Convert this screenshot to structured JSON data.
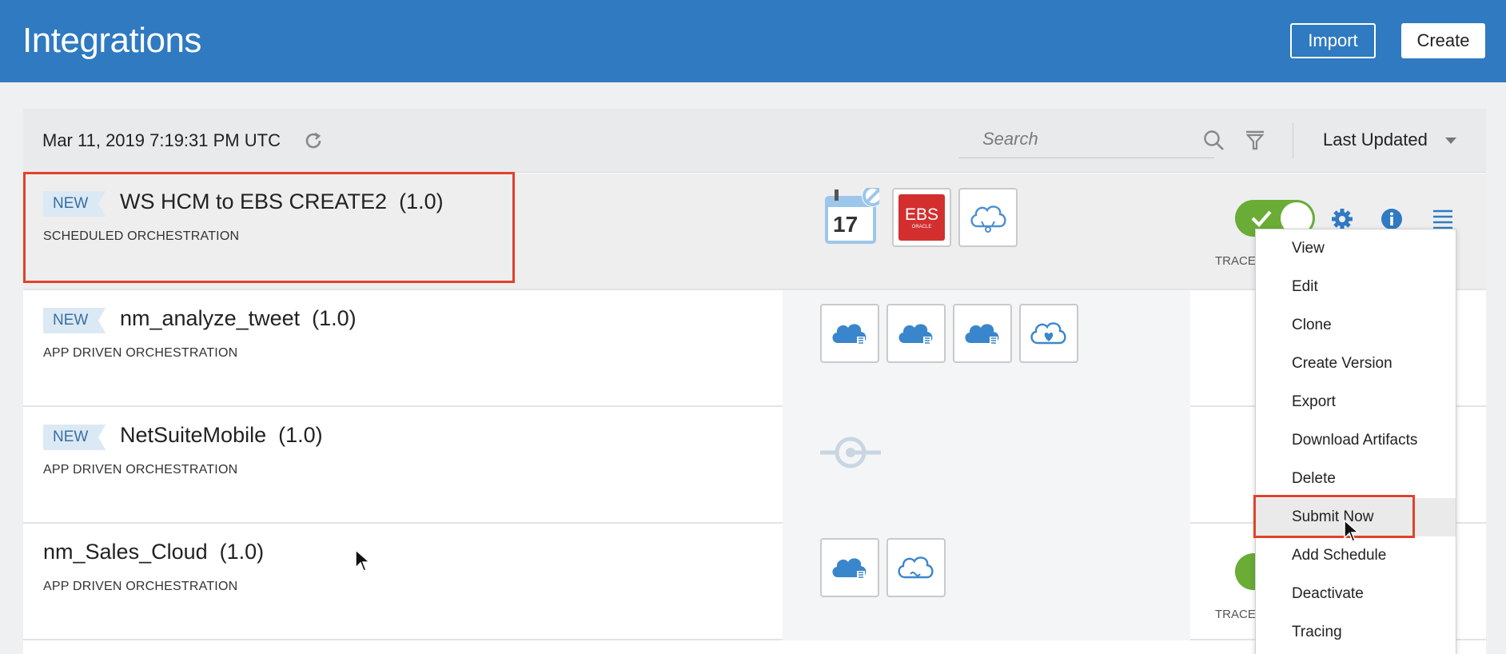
{
  "header": {
    "title": "Integrations",
    "import_label": "Import",
    "create_label": "Create"
  },
  "toolbar": {
    "timestamp": "Mar 11, 2019 7:19:31 PM UTC",
    "search_placeholder": "Search",
    "sort_label": "Last Updated",
    "icons": [
      "refresh-icon",
      "search-icon",
      "filter-icon",
      "chevron-down-icon"
    ]
  },
  "rows": [
    {
      "badge": "NEW",
      "name": "WS HCM to EBS CREATE2",
      "version": "(1.0)",
      "type": "SCHEDULED ORCHESTRATION",
      "trace_label": "TRACE",
      "calendar_day": "17",
      "ebs_label": "EBS",
      "ebs_sub": "ORACLE"
    },
    {
      "badge": "NEW",
      "name": "nm_analyze_tweet",
      "version": "(1.0)",
      "type": "APP DRIVEN ORCHESTRATION"
    },
    {
      "badge": "NEW",
      "name": "NetSuiteMobile",
      "version": "(1.0)",
      "type": "APP DRIVEN ORCHESTRATION"
    },
    {
      "badge": "",
      "name": "nm_Sales_Cloud",
      "version": "(1.0)",
      "type": "APP DRIVEN ORCHESTRATION",
      "trace_label": "TRACE"
    }
  ],
  "menu": {
    "items": [
      "View",
      "Edit",
      "Clone",
      "Create Version",
      "Export",
      "Download Artifacts",
      "Delete",
      "Submit Now",
      "Add Schedule",
      "Deactivate",
      "Tracing"
    ],
    "highlighted": "Submit Now"
  },
  "colors": {
    "header": "#2f7ac1",
    "accent_blue": "#2f7ac1",
    "active_green": "#6aac36",
    "selection_red": "#e0432a",
    "ebs_red": "#d32f2f"
  }
}
